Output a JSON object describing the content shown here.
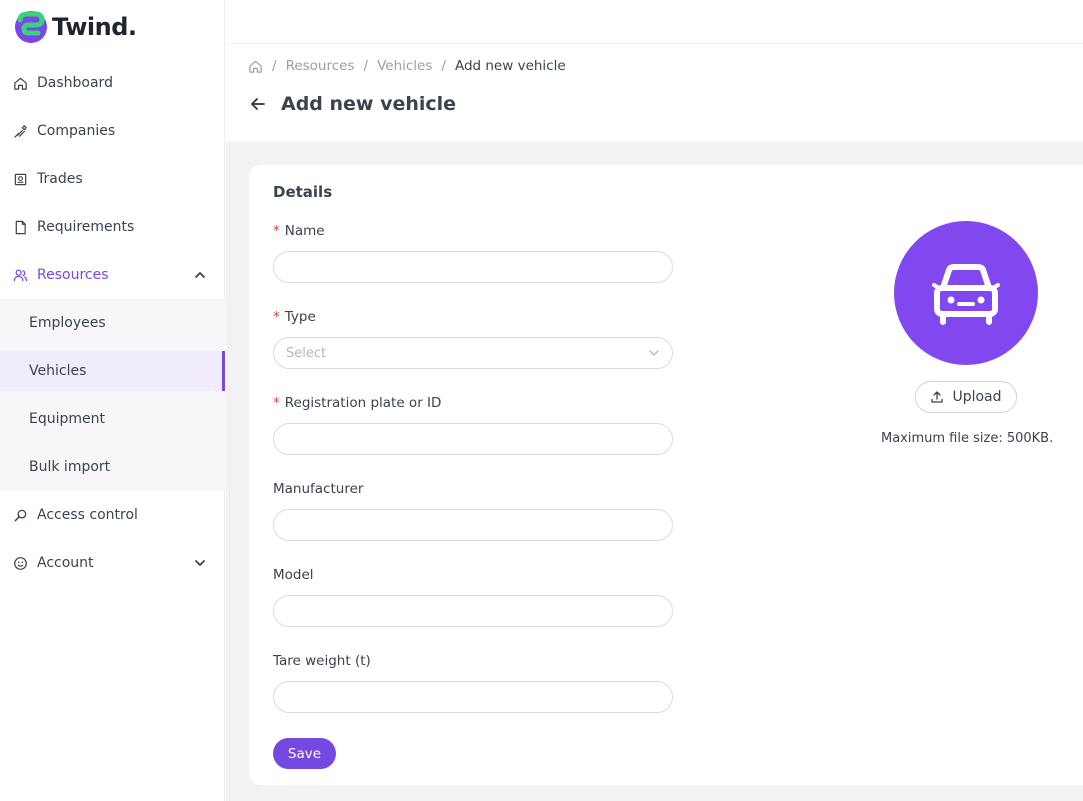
{
  "brand": {
    "name": "Twind.",
    "accent": "#7349e0",
    "logo_colors": [
      "#3bd37a",
      "#7a45ec"
    ]
  },
  "sidebar": {
    "items": [
      {
        "label": "Dashboard",
        "icon": "home-icon"
      },
      {
        "label": "Companies",
        "icon": "handshake-icon"
      },
      {
        "label": "Trades",
        "icon": "certificate-icon"
      },
      {
        "label": "Requirements",
        "icon": "document-icon"
      },
      {
        "label": "Resources",
        "icon": "users-icon",
        "expanded": true
      },
      {
        "label": "Access control",
        "icon": "search-icon"
      },
      {
        "label": "Account",
        "icon": "smile-icon",
        "expanded": false
      }
    ],
    "resources_children": [
      {
        "label": "Employees"
      },
      {
        "label": "Vehicles",
        "selected": true
      },
      {
        "label": "Equipment"
      },
      {
        "label": "Bulk import"
      }
    ]
  },
  "breadcrumb": {
    "items": [
      "Resources",
      "Vehicles"
    ],
    "current": "Add new vehicle",
    "separator": "/"
  },
  "page": {
    "title": "Add new vehicle"
  },
  "form": {
    "section_title": "Details",
    "fields": [
      {
        "label": "Name",
        "required": true,
        "value": "",
        "placeholder": ""
      },
      {
        "label": "Type",
        "required": true,
        "value": "",
        "placeholder": "Select",
        "kind": "select"
      },
      {
        "label": "Registration plate or ID",
        "required": true,
        "value": "",
        "placeholder": ""
      },
      {
        "label": "Manufacturer",
        "required": false,
        "value": "",
        "placeholder": ""
      },
      {
        "label": "Model",
        "required": false,
        "value": "",
        "placeholder": ""
      },
      {
        "label": "Tare weight (t)",
        "required": false,
        "value": "",
        "placeholder": ""
      }
    ],
    "required_marker": "*",
    "save_label": "Save"
  },
  "image_upload": {
    "placeholder_icon": "car-icon",
    "upload_label": "Upload",
    "hint": "Maximum file size: 500KB."
  }
}
